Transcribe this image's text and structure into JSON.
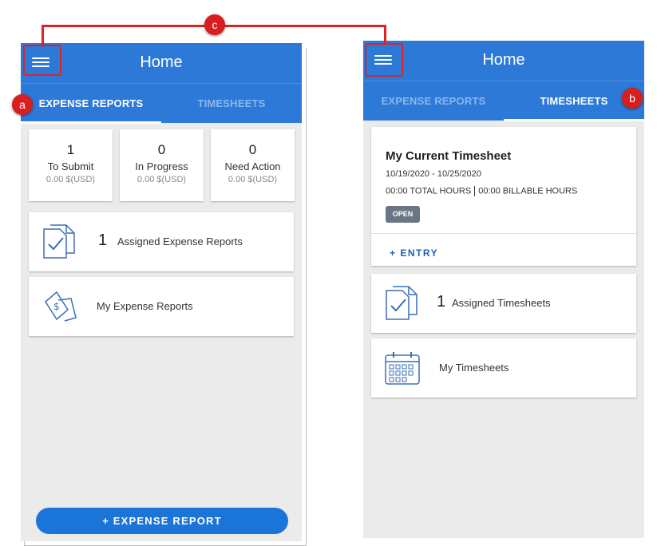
{
  "left_screen": {
    "title": "Home",
    "tabs": [
      {
        "label": "EXPENSE REPORTS",
        "active": true
      },
      {
        "label": "TIMESHEETS",
        "active": false
      }
    ],
    "stats": [
      {
        "count": "1",
        "label": "To Submit",
        "amount": "0.00 $(USD)"
      },
      {
        "count": "0",
        "label": "In Progress",
        "amount": "0.00 $(USD)"
      },
      {
        "count": "0",
        "label": "Need Action",
        "amount": "0.00 $(USD)"
      }
    ],
    "assigned": {
      "count": "1",
      "label": "Assigned Expense Reports"
    },
    "my_reports": {
      "label": "My Expense Reports"
    },
    "fab_label": "+ EXPENSE REPORT"
  },
  "right_screen": {
    "title": "Home",
    "tabs": [
      {
        "label": "EXPENSE REPORTS",
        "active": false
      },
      {
        "label": "TIMESHEETS",
        "active": true
      }
    ],
    "current": {
      "title": "My Current Timesheet",
      "dates": "10/19/2020 - 10/25/2020",
      "total_hours": "00:00 TOTAL HOURS",
      "billable_hours": "00:00 BILLABLE HOURS",
      "status": "OPEN",
      "entry_label": "+ ENTRY"
    },
    "assigned": {
      "count": "1",
      "label": "Assigned Timesheets"
    },
    "my_timesheets": {
      "label": "My Timesheets"
    }
  },
  "callouts": {
    "a": "a",
    "b": "b",
    "c": "c"
  },
  "colors": {
    "primary": "#2d79d8",
    "fab": "#1b74d8",
    "annotation": "#e02222",
    "badge": "#6b7684"
  },
  "icons": [
    "menu-icon",
    "document-check-icon",
    "expense-receipt-icon",
    "calendar-icon"
  ]
}
